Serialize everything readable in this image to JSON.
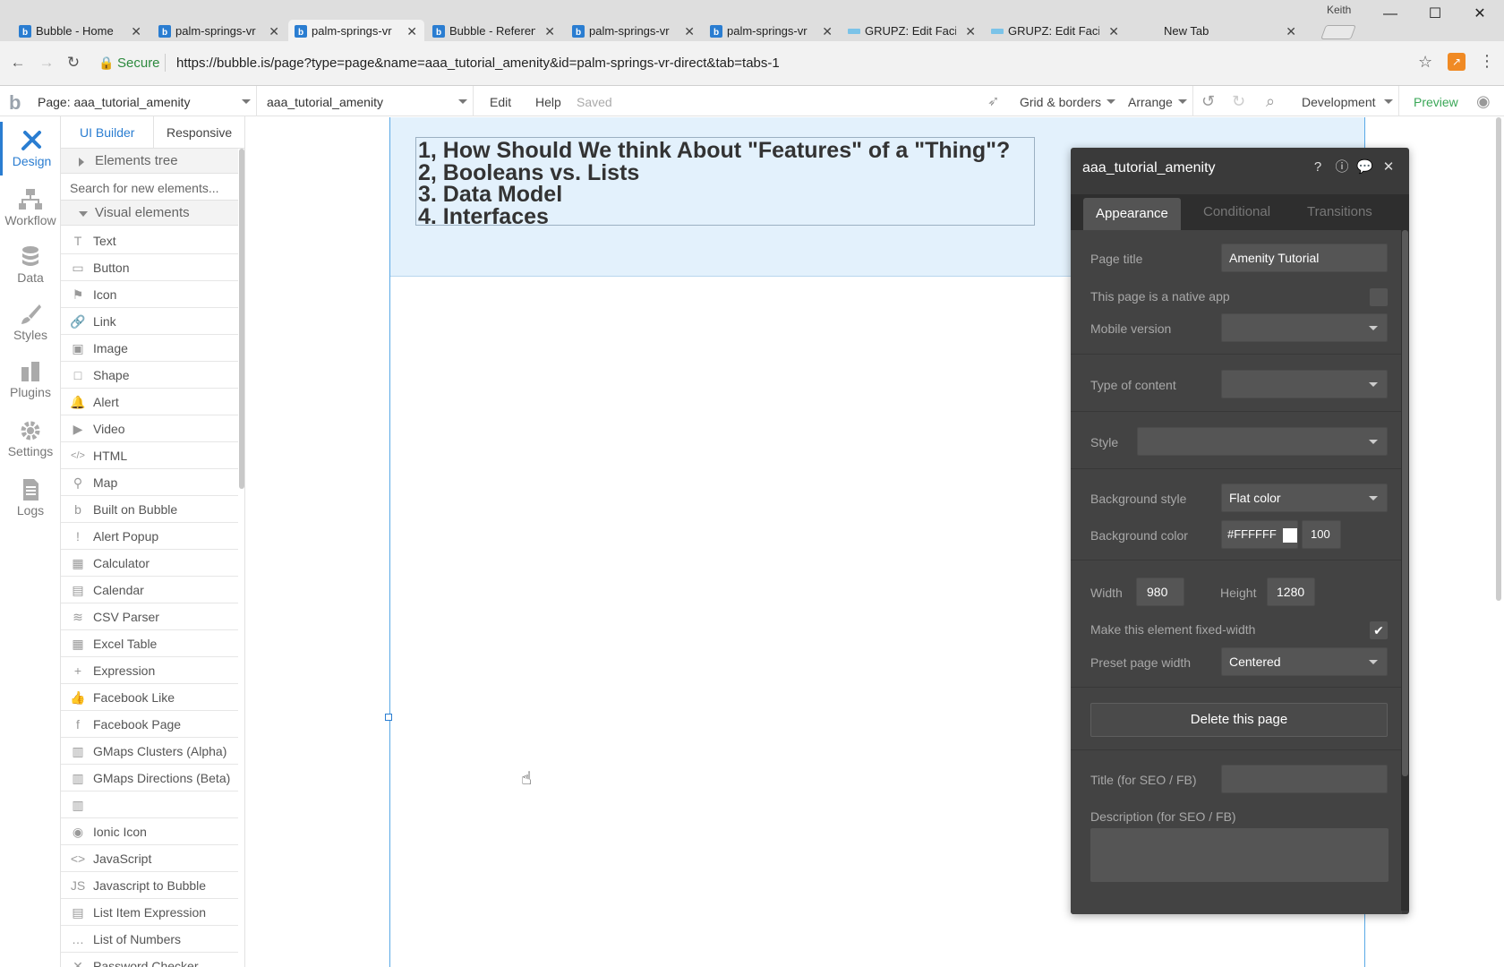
{
  "browser": {
    "tabs": [
      {
        "label": "Bubble - Home"
      },
      {
        "label": "palm-springs-vr"
      },
      {
        "label": "palm-springs-vr"
      },
      {
        "label": "Bubble - Referen"
      },
      {
        "label": "palm-springs-vr"
      },
      {
        "label": "palm-springs-vr"
      },
      {
        "label": "GRUPZ: Edit Faci"
      },
      {
        "label": "GRUPZ: Edit Faci"
      },
      {
        "label": "New Tab"
      }
    ],
    "active_tab_index": 2,
    "user": "Keith",
    "secure_label": "Secure",
    "url": "https://bubble.is/page?type=page&name=aaa_tutorial_amenity&id=palm-springs-vr-direct&tab=tabs-1"
  },
  "topbar": {
    "page_select": "Page: aaa_tutorial_amenity",
    "element_select": "aaa_tutorial_amenity",
    "edit": "Edit",
    "help": "Help",
    "status": "Saved",
    "grid": "Grid & borders",
    "arrange": "Arrange",
    "environment": "Development",
    "preview": "Preview"
  },
  "rail": [
    {
      "label": "Design",
      "icon": "design-icon"
    },
    {
      "label": "Workflow",
      "icon": "workflow-icon"
    },
    {
      "label": "Data",
      "icon": "database-icon"
    },
    {
      "label": "Styles",
      "icon": "brush-icon"
    },
    {
      "label": "Plugins",
      "icon": "plugins-icon"
    },
    {
      "label": "Settings",
      "icon": "gear-icon"
    },
    {
      "label": "Logs",
      "icon": "document-icon"
    }
  ],
  "panel": {
    "tab_builder": "UI Builder",
    "tab_responsive": "Responsive",
    "elements_tree": "Elements tree",
    "search_placeholder": "Search for new elements...",
    "visual_elements": "Visual elements",
    "elements": [
      {
        "label": "Text",
        "glyph": "T"
      },
      {
        "label": "Button",
        "glyph": "▭"
      },
      {
        "label": "Icon",
        "glyph": "⚑"
      },
      {
        "label": "Link",
        "glyph": "🔗"
      },
      {
        "label": "Image",
        "glyph": "▣"
      },
      {
        "label": "Shape",
        "glyph": "□"
      },
      {
        "label": "Alert",
        "glyph": "🔔"
      },
      {
        "label": "Video",
        "glyph": "▶"
      },
      {
        "label": "HTML",
        "glyph": "</>"
      },
      {
        "label": "Map",
        "glyph": "⚲"
      },
      {
        "label": "Built on Bubble",
        "glyph": "b"
      },
      {
        "label": "Alert Popup",
        "glyph": "!"
      },
      {
        "label": "Calculator",
        "glyph": "▦"
      },
      {
        "label": "Calendar",
        "glyph": "▤"
      },
      {
        "label": "CSV Parser",
        "glyph": "≋"
      },
      {
        "label": "Excel Table",
        "glyph": "▦"
      },
      {
        "label": "Expression",
        "glyph": "+"
      },
      {
        "label": "Facebook Like",
        "glyph": "👍"
      },
      {
        "label": "Facebook Page",
        "glyph": "f"
      },
      {
        "label": "GMaps Clusters (Alpha)",
        "glyph": "▥"
      },
      {
        "label": "GMaps Directions (Beta)",
        "glyph": "▥"
      },
      {
        "label": "",
        "glyph": "▥"
      },
      {
        "label": "Ionic Icon",
        "glyph": "◉"
      },
      {
        "label": "JavaScript",
        "glyph": "<>"
      },
      {
        "label": "Javascript to Bubble",
        "glyph": "JS"
      },
      {
        "label": "List Item Expression",
        "glyph": "▤"
      },
      {
        "label": "List of Numbers",
        "glyph": "…"
      },
      {
        "label": "Password Checker",
        "glyph": "✕"
      }
    ]
  },
  "canvas": {
    "lines": [
      "1, How Should We think About \"Features\" of a \"Thing\"?",
      "2, Booleans vs. Lists",
      "3. Data Model",
      "4. Interfaces"
    ]
  },
  "property_editor": {
    "title": "aaa_tutorial_amenity",
    "tabs": [
      "Appearance",
      "Conditional",
      "Transitions"
    ],
    "page_title_label": "Page title",
    "page_title_value": "Amenity Tutorial",
    "native_app_label": "This page is a native app",
    "mobile_version_label": "Mobile version",
    "type_of_content_label": "Type of content",
    "style_label": "Style",
    "background_style_label": "Background style",
    "background_style_value": "Flat color",
    "background_color_label": "Background color",
    "background_color_value": "#FFFFFF",
    "background_opacity": "100",
    "width_label": "Width",
    "width_value": "980",
    "height_label": "Height",
    "height_value": "1280",
    "fixed_width_label": "Make this element fixed-width",
    "fixed_width_checked": "✔",
    "preset_width_label": "Preset page width",
    "preset_width_value": "Centered",
    "delete_button": "Delete this page",
    "seo_title_label": "Title (for SEO / FB)",
    "seo_description_label": "Description (for SEO / FB)"
  },
  "colors": {
    "accent": "#2a7dd1",
    "preview": "#3aa757",
    "canvas_group": "#e3f1fc",
    "panel_dark": "#3a3a3a"
  }
}
